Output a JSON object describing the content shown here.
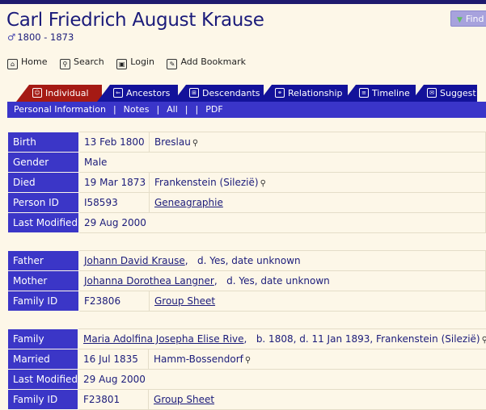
{
  "header": {
    "title": "Carl Friedrich August Krause",
    "gender_symbol": "♂",
    "dates": "1800 - 1873",
    "find_label": "Find"
  },
  "toolbar": [
    {
      "label": "Home",
      "icon": "home-icon"
    },
    {
      "label": "Search",
      "icon": "search-icon"
    },
    {
      "label": "Login",
      "icon": "lock-icon"
    },
    {
      "label": "Add Bookmark",
      "icon": "bookmark-icon"
    }
  ],
  "tabs": [
    {
      "label": "Individual",
      "active": true
    },
    {
      "label": "Ancestors"
    },
    {
      "label": "Descendants"
    },
    {
      "label": "Relationship"
    },
    {
      "label": "Timeline"
    },
    {
      "label": "Suggest"
    }
  ],
  "subnav": [
    "Personal Information",
    "Notes",
    "All",
    "PDF"
  ],
  "individual": {
    "birth_label": "Birth",
    "birth_date": "13 Feb 1800",
    "birth_place": "Breslau",
    "gender_label": "Gender",
    "gender": "Male",
    "died_label": "Died",
    "died_date": "19 Mar 1873",
    "died_place": "Frankenstein (Silezië)",
    "person_id_label": "Person ID",
    "person_id": "I58593",
    "source": "Geneagraphie",
    "last_modified_label": "Last Modified",
    "last_modified": "29 Aug 2000"
  },
  "parents": {
    "father_label": "Father",
    "father": "Johann David Krause",
    "father_note": "d. Yes, date unknown",
    "mother_label": "Mother",
    "mother": "Johanna Dorothea Langner",
    "mother_note": "d. Yes, date unknown",
    "family_id_label": "Family ID",
    "family_id": "F23806",
    "group_sheet": "Group Sheet"
  },
  "family": {
    "family_label": "Family",
    "spouse": "Maria Adolfina Josepha Elise Rive",
    "spouse_note": "b. 1808,   d. 11 Jan 1893, Frankenstein (Silezië)",
    "married_label": "Married",
    "married_date": "16 Jul 1835",
    "married_place": "Hamm-Bossendorf",
    "last_modified_label": "Last Modified",
    "last_modified": "29 Aug 2000",
    "family_id_label": "Family ID",
    "family_id": "F23801",
    "group_sheet": "Group Sheet"
  }
}
